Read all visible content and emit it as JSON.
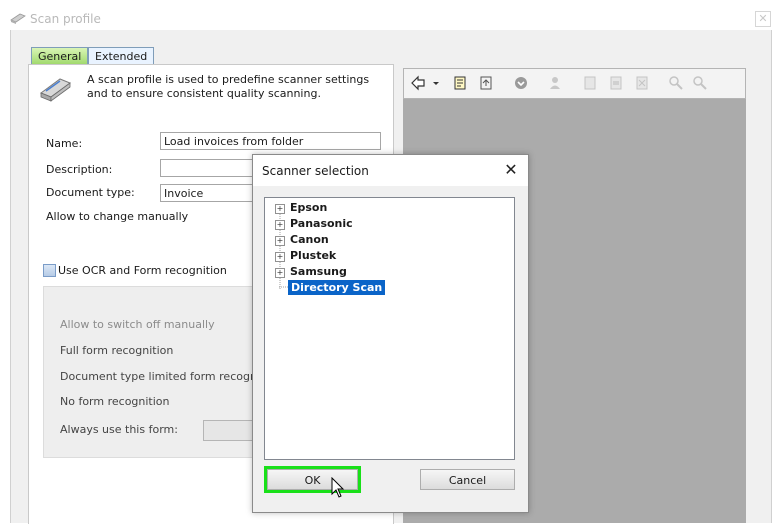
{
  "window": {
    "title": "Scan profile",
    "close_glyph": "✕"
  },
  "tabs": [
    {
      "label": "General"
    },
    {
      "label": "Extended"
    }
  ],
  "general": {
    "intro": "A scan profile is used to predefine scanner settings and to ensure consistent quality scanning.",
    "name_label": "Name:",
    "name_value": "Load invoices from folder",
    "description_label": "Description:",
    "description_value": "",
    "doctype_label": "Document type:",
    "doctype_value": "Invoice",
    "allow_change_label": "Allow to change manually",
    "ocr_label": "Use OCR and Form recognition",
    "ocr_options": {
      "switch_off": "Allow to switch off manually",
      "full": "Full form recognition",
      "limited": "Document type limited form recognition",
      "none": "No form recognition",
      "always": "Always use this form:"
    }
  },
  "dialog": {
    "title": "Scanner selection",
    "close_glyph": "✕",
    "tree": [
      {
        "label": "Epson",
        "expandable": true
      },
      {
        "label": "Panasonic",
        "expandable": true
      },
      {
        "label": "Canon",
        "expandable": true
      },
      {
        "label": "Plustek",
        "expandable": true
      },
      {
        "label": "Samsung",
        "expandable": true
      },
      {
        "label": "Directory Scan",
        "expandable": false,
        "selected": true
      }
    ],
    "ok_label": "OK",
    "cancel_label": "Cancel"
  },
  "icons": {
    "app": "scanner-icon",
    "toolbar": [
      "back-arrow-icon",
      "dropdown-arrow-icon",
      "scan-document-icon",
      "import-icon",
      "shield-icon",
      "user-icon",
      "page-icon",
      "page-copy-icon",
      "page-delete-icon",
      "zoom-in-icon",
      "zoom-out-icon"
    ]
  },
  "colors": {
    "tab_active": "#9ed86a",
    "selection": "#0a64c8",
    "highlight": "#19e019",
    "viewer_bg": "#ababab"
  }
}
